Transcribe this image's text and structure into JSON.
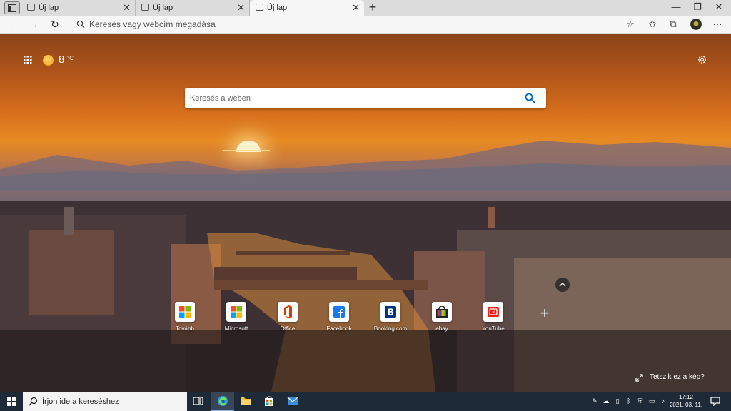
{
  "browser": {
    "tabs": [
      {
        "label": "Új lap",
        "active": false
      },
      {
        "label": "Új lap",
        "active": false
      },
      {
        "label": "Új lap",
        "active": true
      }
    ],
    "close_glyph": "✕",
    "new_tab_glyph": "+",
    "window_controls": {
      "minimize": "—",
      "restore": "❐",
      "close": "✕"
    },
    "nav": {
      "back": "←",
      "forward": "→",
      "refresh": "↻"
    },
    "address_placeholder": "Keresés vagy webcím megadása",
    "more_glyph": "···"
  },
  "newtab": {
    "weather": {
      "temp": "8",
      "unit": "°C",
      "icon": "sun-icon"
    },
    "search_placeholder": "Keresés a weben",
    "quick_links": [
      {
        "label": "Tovább",
        "icon": "microsoft-icon"
      },
      {
        "label": "Microsoft",
        "icon": "microsoft-icon"
      },
      {
        "label": "Office",
        "icon": "office-icon"
      },
      {
        "label": "Facebook",
        "icon": "facebook-icon"
      },
      {
        "label": "Booking.com",
        "icon": "booking-icon"
      },
      {
        "label": "ebay",
        "icon": "ebay-icon"
      },
      {
        "label": "YouTube",
        "icon": "youtube-icon"
      }
    ],
    "add_site_glyph": "+",
    "like_image": "Tetszik ez a kép?"
  },
  "taskbar": {
    "search_placeholder": "Írjon ide a kereséshez",
    "time": "17:12",
    "date": "2021. 03. 11."
  },
  "colors": {
    "accent": "#0067b8",
    "taskbar": "#1f2a38"
  }
}
